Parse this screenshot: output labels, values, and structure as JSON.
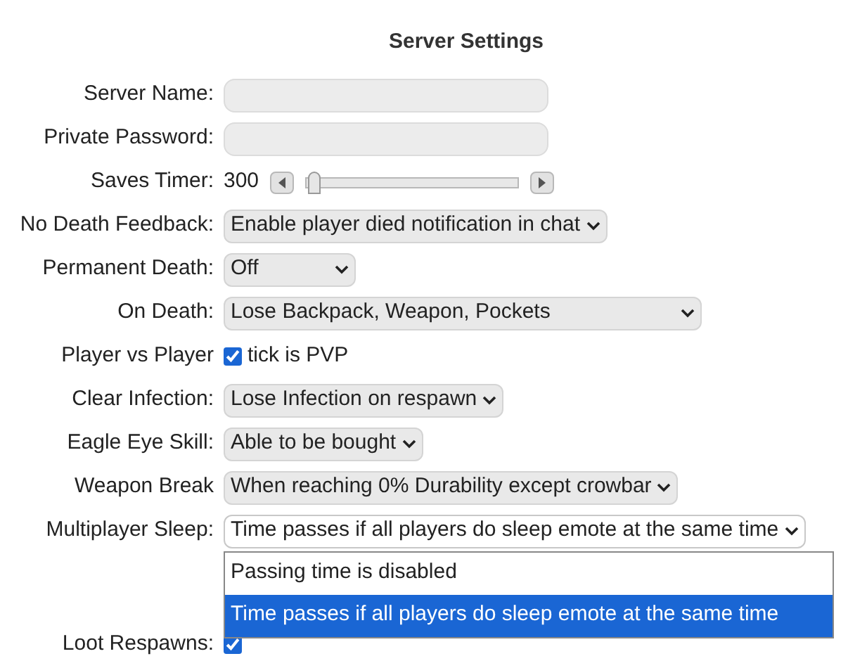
{
  "title": "Server Settings",
  "fields": [
    {
      "kind": "text",
      "label": "Server Name:"
    },
    {
      "kind": "text",
      "label": "Private Password:"
    },
    {
      "kind": "slider",
      "label": "Saves Timer:",
      "value": "300",
      "level": 0.03
    },
    {
      "kind": "select",
      "label": "No Death Feedback:",
      "value": "Enable player died notification in chat",
      "expanded": false
    },
    {
      "kind": "select",
      "label": "Permanent Death:",
      "value": "Off",
      "expanded": false
    },
    {
      "kind": "select",
      "label": "On Death:",
      "value": "Lose Backpack, Weapon, Pockets",
      "expanded": false
    },
    {
      "kind": "checkbox",
      "label": "Player vs Player",
      "text": "tick is PVP",
      "checked": true
    },
    {
      "kind": "select",
      "label": "Clear Infection:",
      "value": "Lose Infection on respawn",
      "expanded": false
    },
    {
      "kind": "select",
      "label": "Eagle Eye Skill:",
      "value": "Able to be bought",
      "expanded": false
    },
    {
      "kind": "select",
      "label": "Weapon Break",
      "value": "When reaching 0% Durability except crowbar",
      "expanded": false
    },
    {
      "kind": "select",
      "label": "Multiplayer Sleep:",
      "value": "Time passes if all players do sleep emote at the same time",
      "expanded": true,
      "options": [
        {
          "label": "Passing time is disabled",
          "selected": false
        },
        {
          "label": "Time passes if all players do sleep emote at the same time",
          "selected": true
        }
      ]
    },
    {
      "kind": "checkbox",
      "label": "Loot Respawns:",
      "checked": true
    }
  ]
}
